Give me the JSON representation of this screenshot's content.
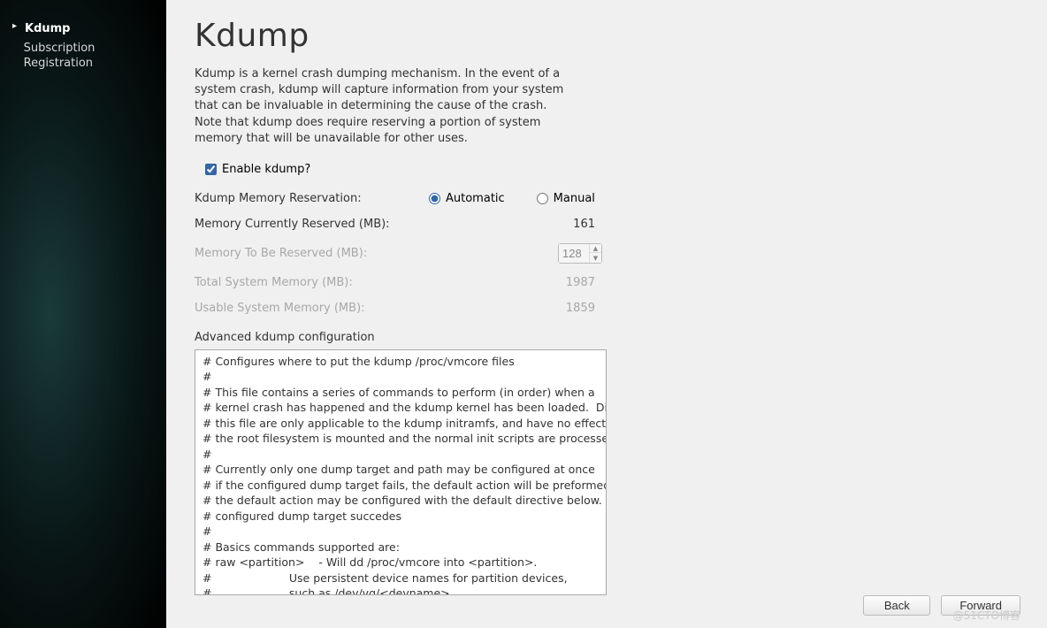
{
  "sidebar": {
    "items": [
      {
        "label": "Kdump",
        "active": true
      },
      {
        "label": "Subscription Registration",
        "active": false
      }
    ]
  },
  "page": {
    "title": "Kdump",
    "description": "Kdump is a kernel crash dumping mechanism. In the event of a system crash, kdump will capture information from your system that can be invaluable in determining the cause of the crash. Note that kdump does require reserving a portion of system memory that will be unavailable for other uses."
  },
  "enable": {
    "label": "Enable kdump?",
    "checked": true
  },
  "reservation": {
    "label": "Kdump Memory Reservation:",
    "automatic_label": "Automatic",
    "manual_label": "Manual",
    "selected": "automatic"
  },
  "memory": {
    "current_label": "Memory Currently Reserved (MB):",
    "current_value": "161",
    "tobe_label": "Memory To Be Reserved (MB):",
    "tobe_value": "128",
    "total_label": "Total System Memory (MB):",
    "total_value": "1987",
    "usable_label": "Usable System Memory (MB):",
    "usable_value": "1859"
  },
  "advanced": {
    "label": "Advanced kdump configuration",
    "content": "# Configures where to put the kdump /proc/vmcore files\n#\n# This file contains a series of commands to perform (in order) when a\n# kernel crash has happened and the kdump kernel has been loaded.  Directives in\n# this file are only applicable to the kdump initramfs, and have no effect if\n# the root filesystem is mounted and the normal init scripts are processed\n#\n# Currently only one dump target and path may be configured at once\n# if the configured dump target fails, the default action will be preformed\n# the default action may be configured with the default directive below.  If the configured\n# configured dump target succedes\n#\n# Basics commands supported are:\n# raw <partition>    - Will dd /proc/vmcore into <partition>.\n#                      Use persistent device names for partition devices,\n#                      such as /dev/vg/<devname>.\n#\n# nfs <nfs mount>         - Will mount fs and copy /proc/vmcore to\n#                      <mnt>/var/crash/%HOST-%DATE/, supports DNS."
  },
  "footer": {
    "back_label": "Back",
    "forward_label": "Forward"
  },
  "watermark": "@51CTO博客"
}
